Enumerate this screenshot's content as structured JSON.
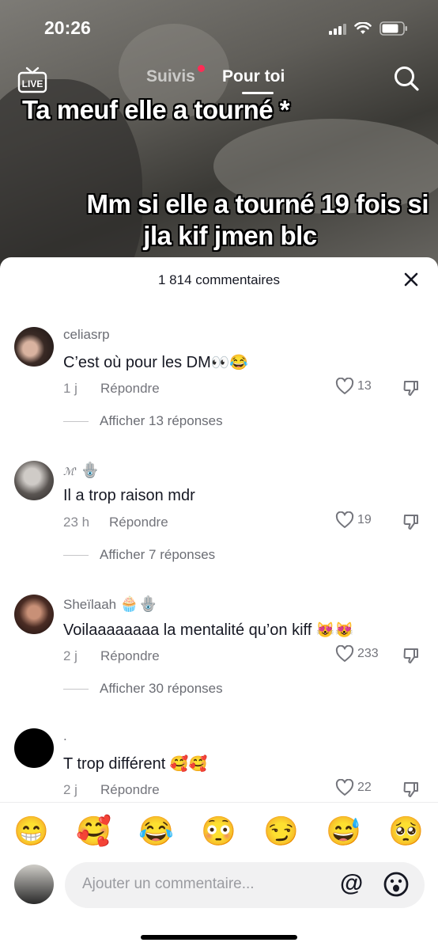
{
  "status_bar": {
    "time": "20:26"
  },
  "top_nav": {
    "live_label": "LIVE",
    "tabs": [
      {
        "label": "Suivis",
        "has_notification_dot": true
      },
      {
        "label": "Pour toi",
        "active": true
      }
    ]
  },
  "video": {
    "caption_top": "Ta meuf elle a tourné *",
    "caption_bottom_line1": "Mm si elle a tourné 19 fois si",
    "caption_bottom_line2": "jla kif jmen blc"
  },
  "comments_sheet": {
    "title": "1 814 commentaires",
    "reply_label": "Répondre",
    "comments": [
      {
        "username": "celiasrp",
        "text": "C’est où pour les DM",
        "text_emoji": "👀😂",
        "time": "1 j",
        "likes": "13",
        "replies_label": "Afficher 13 réponses"
      },
      {
        "username": "ℳ'",
        "username_emoji": "🪬",
        "text": "Il a trop raison mdr",
        "time": "23 h",
        "likes": "19",
        "replies_label": "Afficher 7 réponses"
      },
      {
        "username": "Sheïlaah",
        "username_emoji": "🧁🪬",
        "text": "Voilaaaaaaaa la mentalité qu’on kiff",
        "text_emoji": "😻😻",
        "time": "2 j",
        "likes": "233",
        "replies_label": "Afficher 30 réponses"
      },
      {
        "username": ".",
        "text": "T trop différent",
        "text_emoji": "🥰🥰",
        "time": "2 j",
        "likes": "22"
      }
    ]
  },
  "emoji_bar": [
    "😁",
    "🥰",
    "😂",
    "😳",
    "😏",
    "😅",
    "🥺"
  ],
  "composer": {
    "placeholder": "Ajouter un commentaire...",
    "mention_symbol": "@"
  },
  "colors": {
    "notification_dot": "#fe2c55",
    "text_primary": "#161823",
    "text_secondary": "#73747b"
  },
  "icons": [
    "live-icon",
    "search-icon",
    "close-icon",
    "heart-icon",
    "dislike-icon",
    "smiley-icon"
  ]
}
